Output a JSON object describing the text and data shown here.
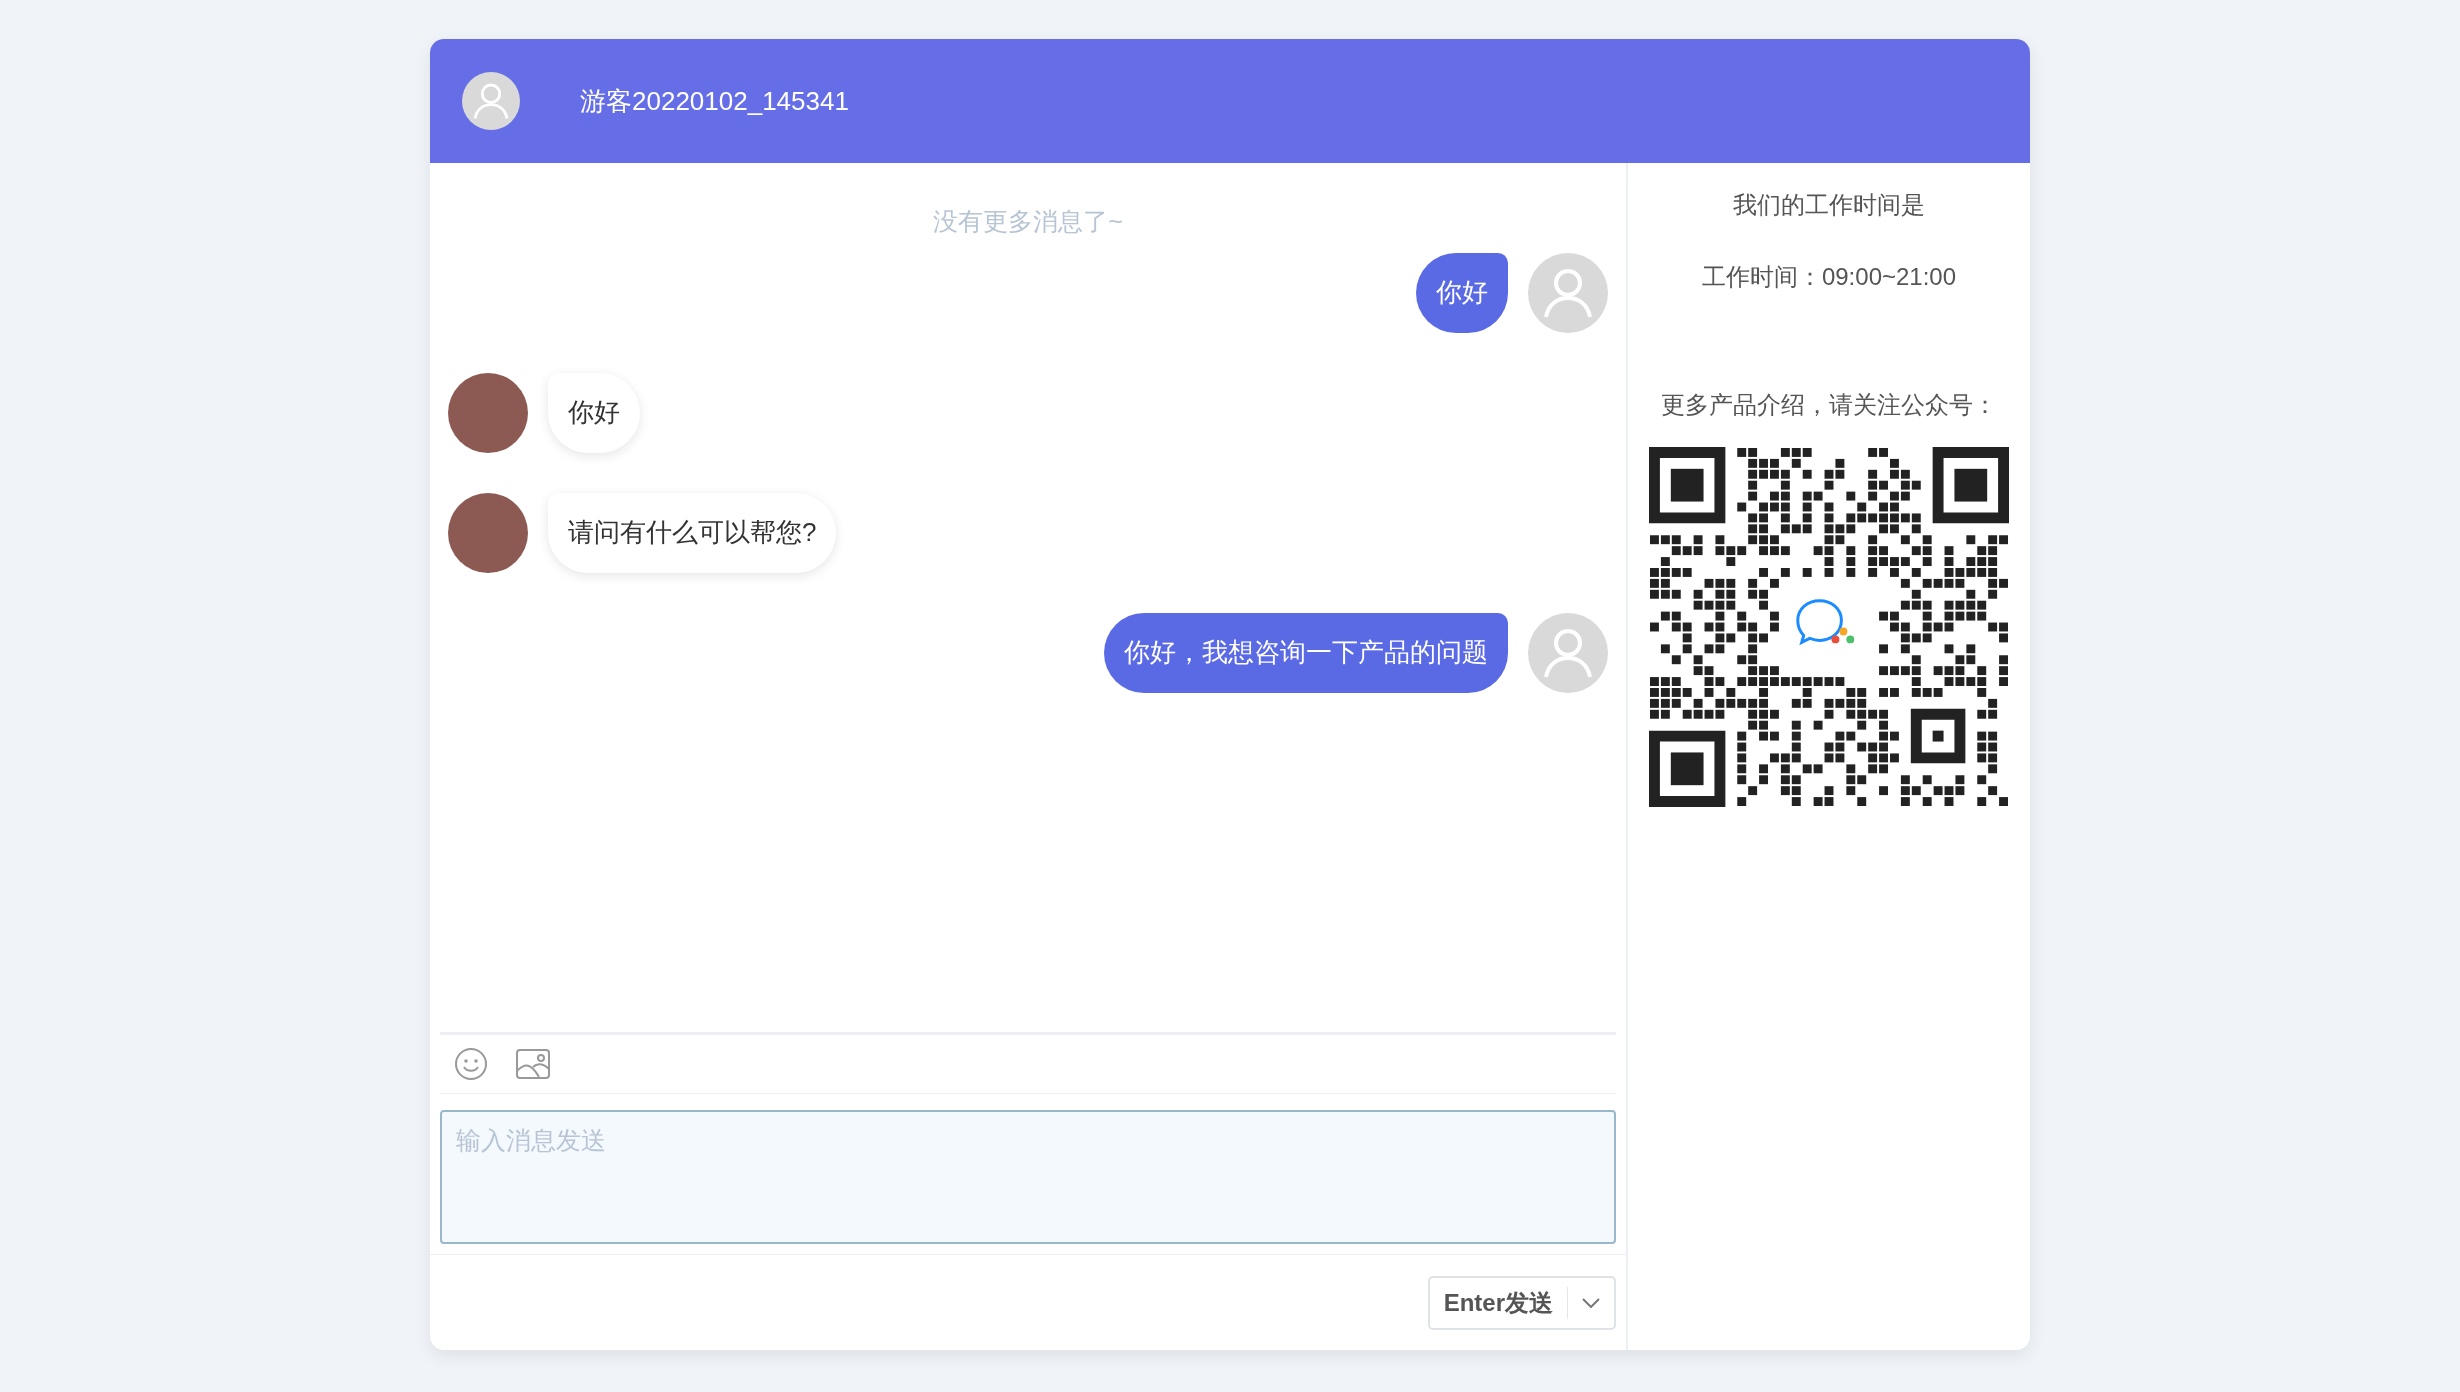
{
  "header": {
    "title": "游客20220102_145341"
  },
  "chat": {
    "history_note": "没有更多消息了~",
    "messages": [
      {
        "kind": "sent",
        "text": "你好"
      },
      {
        "kind": "received",
        "text": "你好"
      },
      {
        "kind": "received",
        "text": "请问有什么可以帮您?"
      },
      {
        "kind": "sent",
        "text": "你好，我想咨询一下产品的问题"
      }
    ]
  },
  "composer": {
    "placeholder": "输入消息发送",
    "send_button": "Enter发送"
  },
  "side_panel": {
    "hours_title": "我们的工作时间是",
    "hours": "工作时间：09:00~21:00",
    "follow_note": "更多产品介绍，请关注公众号："
  }
}
